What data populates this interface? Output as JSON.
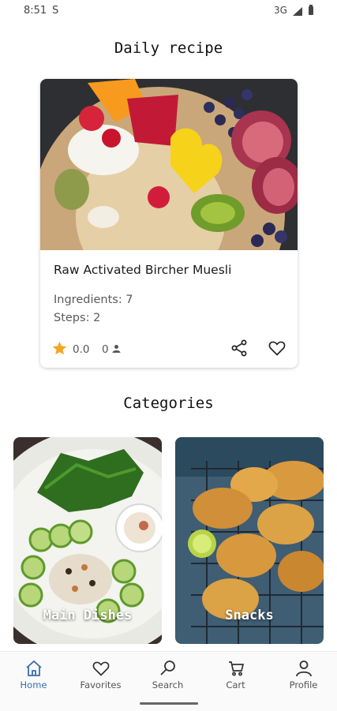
{
  "status_bar": {
    "time": "8:51",
    "sim_indicator": "S",
    "network": "3G"
  },
  "daily_recipe": {
    "section_title": "Daily recipe",
    "name": "Raw Activated Bircher Muesli",
    "ingredients_text": "Ingredients: 7",
    "steps_text": "Steps: 2",
    "rating": "0.0",
    "rating_count": "0",
    "icons": [
      "star-icon",
      "person-icon",
      "share-icon",
      "heart-icon"
    ]
  },
  "categories": {
    "section_title": "Categories",
    "items": [
      {
        "label": "Main Dishes"
      },
      {
        "label": "Snacks"
      }
    ]
  },
  "bottom_nav": {
    "items": [
      {
        "label": "Home",
        "icon": "home-icon",
        "active": true
      },
      {
        "label": "Favorites",
        "icon": "heart-icon",
        "active": false
      },
      {
        "label": "Search",
        "icon": "search-icon",
        "active": false
      },
      {
        "label": "Cart",
        "icon": "cart-icon",
        "active": false
      },
      {
        "label": "Profile",
        "icon": "profile-icon",
        "active": false
      }
    ]
  },
  "colors": {
    "accent": "#3a6fb0",
    "star": "#f5a623",
    "text_muted": "#5a5a5a"
  }
}
